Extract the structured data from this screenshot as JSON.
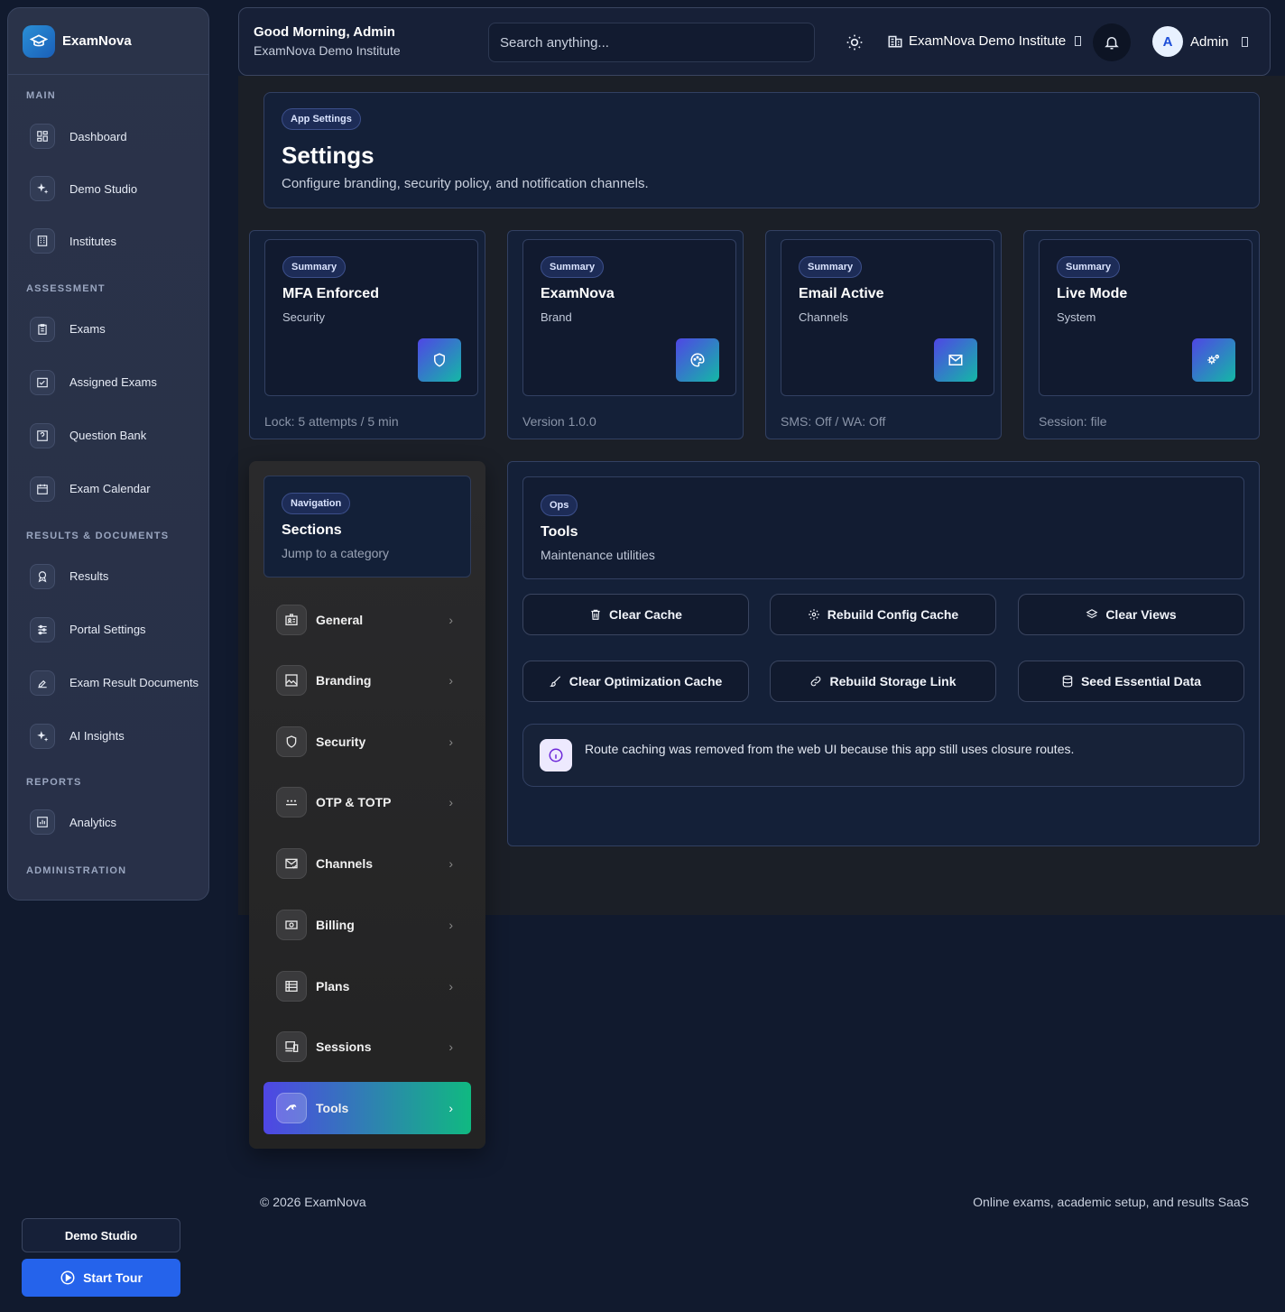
{
  "brand": {
    "name": "ExamNova"
  },
  "sidebar": {
    "sections": [
      {
        "title": "MAIN",
        "items": [
          {
            "label": "Dashboard",
            "icon": "dashboard-icon"
          },
          {
            "label": "Demo Studio",
            "icon": "sparkle-icon"
          },
          {
            "label": "Institutes",
            "icon": "building-icon"
          }
        ]
      },
      {
        "title": "ASSESSMENT",
        "items": [
          {
            "label": "Exams",
            "icon": "clipboard-icon"
          },
          {
            "label": "Assigned Exams",
            "icon": "assign-icon"
          },
          {
            "label": "Question Bank",
            "icon": "question-icon"
          },
          {
            "label": "Exam Calendar",
            "icon": "calendar-icon"
          }
        ]
      },
      {
        "title": "RESULTS & DOCUMENTS",
        "items": [
          {
            "label": "Results",
            "icon": "award-icon"
          },
          {
            "label": "Portal Settings",
            "icon": "sliders-icon"
          },
          {
            "label": "Exam Result Documents",
            "icon": "document-icon"
          },
          {
            "label": "AI Insights",
            "icon": "sparkle-icon"
          }
        ]
      },
      {
        "title": "REPORTS",
        "items": [
          {
            "label": "Analytics",
            "icon": "chart-icon"
          }
        ]
      },
      {
        "title": "ADMINISTRATION",
        "items": []
      }
    ],
    "footer": {
      "demo_label": "Demo Studio",
      "tour_label": "Start Tour"
    }
  },
  "topbar": {
    "greeting": "Good Morning, Admin",
    "institute_sub": "ExamNova Demo Institute",
    "search_placeholder": "Search anything...",
    "institute_selector": "ExamNova Demo Institute",
    "user_initial": "A",
    "user_name": "Admin"
  },
  "header": {
    "pill": "App Settings",
    "title": "Settings",
    "subtitle": "Configure branding, security policy, and notification channels."
  },
  "stats": [
    {
      "pill": "Summary",
      "title": "MFA Enforced",
      "sub": "Security",
      "footer": "Lock: 5 attempts / 5 min",
      "icon": "shield-icon"
    },
    {
      "pill": "Summary",
      "title": "ExamNova",
      "sub": "Brand",
      "footer": "Version 1.0.0",
      "icon": "palette-icon"
    },
    {
      "pill": "Summary",
      "title": "Email Active",
      "sub": "Channels",
      "footer": "SMS: Off / WA: Off",
      "icon": "mail-icon"
    },
    {
      "pill": "Summary",
      "title": "Live Mode",
      "sub": "System",
      "footer": "Session: file",
      "icon": "gears-icon"
    }
  ],
  "sections_nav": {
    "pill": "Navigation",
    "title": "Sections",
    "subtitle": "Jump to a category",
    "items": [
      {
        "label": "General",
        "icon": "id-card-icon"
      },
      {
        "label": "Branding",
        "icon": "image-icon"
      },
      {
        "label": "Security",
        "icon": "shield-icon"
      },
      {
        "label": "OTP & TOTP",
        "icon": "password-icon"
      },
      {
        "label": "Channels",
        "icon": "mail-check-icon"
      },
      {
        "label": "Billing",
        "icon": "money-icon"
      },
      {
        "label": "Plans",
        "icon": "list-icon"
      },
      {
        "label": "Sessions",
        "icon": "devices-icon"
      },
      {
        "label": "Tools",
        "icon": "wrench-icon",
        "active": true
      }
    ]
  },
  "tools": {
    "pill": "Ops",
    "title": "Tools",
    "subtitle": "Maintenance utilities",
    "buttons": [
      {
        "label": "Clear Cache",
        "icon": "trash-icon"
      },
      {
        "label": "Rebuild Config Cache",
        "icon": "gear-icon"
      },
      {
        "label": "Clear Views",
        "icon": "layers-icon"
      },
      {
        "label": "Clear Optimization Cache",
        "icon": "brush-icon"
      },
      {
        "label": "Rebuild Storage Link",
        "icon": "link-icon"
      },
      {
        "label": "Seed Essential Data",
        "icon": "database-icon"
      }
    ],
    "notice": "Route caching was removed from the web UI because this app still uses closure routes."
  },
  "footer": {
    "copyright": "© 2026 ExamNova",
    "tagline": "Online exams, academic setup, and results SaaS"
  },
  "colors": {
    "accent": "#2563eb",
    "active_gradient_start": "#4f46e5",
    "active_gradient_end": "#10b981"
  }
}
